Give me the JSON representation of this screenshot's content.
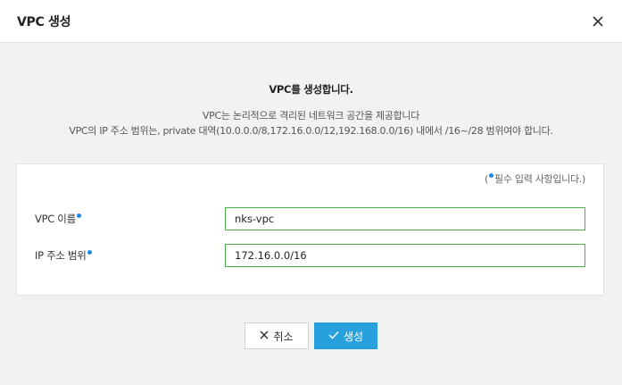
{
  "dialog": {
    "title": "VPC 생성",
    "close_icon": "close-icon"
  },
  "intro": {
    "heading": "VPC를 생성합니다.",
    "desc_line1": "VPC는 논리적으로 격리된 네트워크 공간을 제공합니다",
    "desc_line2": "VPC의 IP 주소 범위는, private 대역(10.0.0.0/8,172.16.0.0/12,192.168.0.0/16) 내에서 /16~/28 범위여야 합니다."
  },
  "form": {
    "required_note_open": "(",
    "required_note_text": "필수 입력 사항입니다.)",
    "fields": [
      {
        "label": "VPC 이름",
        "value": "nks-vpc"
      },
      {
        "label": "IP 주소 범위",
        "value": "172.16.0.0/16"
      }
    ]
  },
  "buttons": {
    "cancel_label": "취소",
    "cancel_icon": "x-icon",
    "create_label": "생성",
    "create_icon": "check-icon"
  },
  "colors": {
    "accent": "#28a0de",
    "required_dot": "#1e88e5",
    "input_border": "#4caf50"
  }
}
